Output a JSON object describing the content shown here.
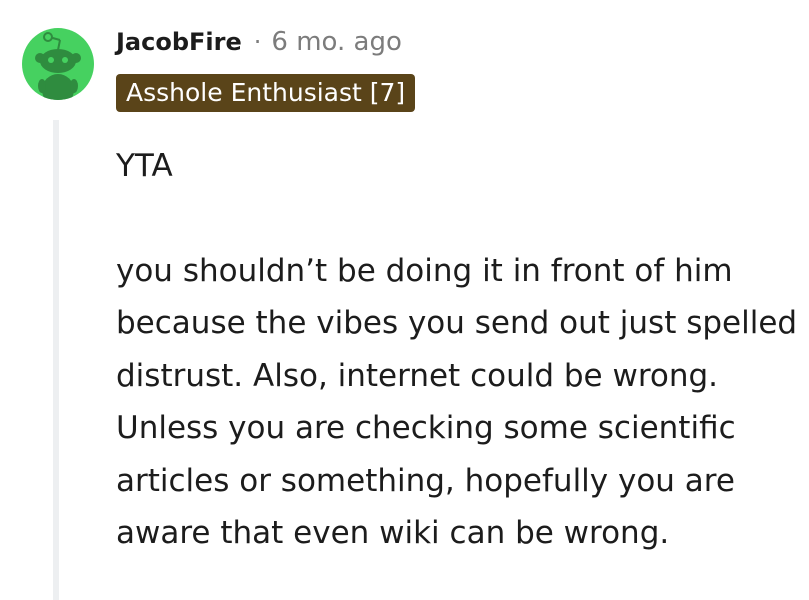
{
  "comment": {
    "author": "JacobFire",
    "separator": "·",
    "timestamp": "6 mo. ago",
    "flair": "Asshole Enthusiast [7]",
    "avatar_icon": "snoo-avatar-icon",
    "body": [
      "YTA",
      "you shouldn’t be doing it in front of him because the vibes you send out just spelled distrust. Also, internet could be wrong. Unless you are checking some scientific articles or something, hopefully you are aware that even wiki can be wrong."
    ]
  },
  "colors": {
    "avatar_bg": "#46d160",
    "flair_bg": "#5a4419",
    "flair_text": "#ffffff",
    "meta_text": "#7c7c7c",
    "thread_line": "#edeff1"
  }
}
